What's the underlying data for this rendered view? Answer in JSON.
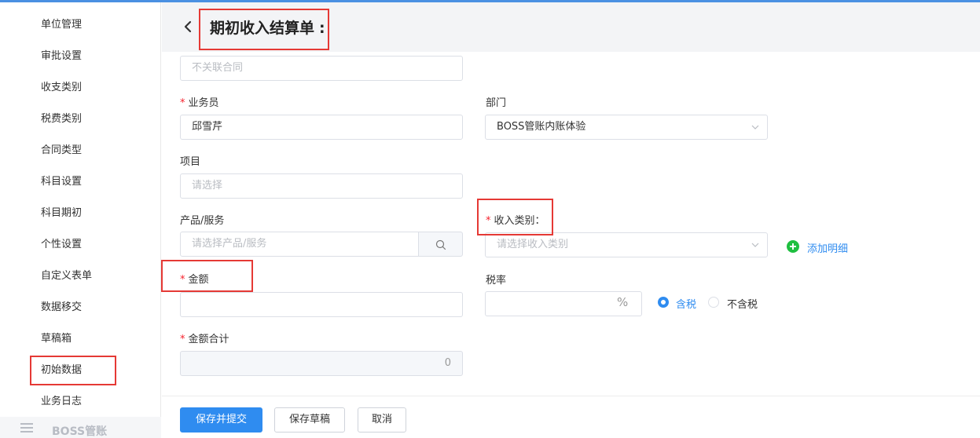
{
  "sidebar": {
    "items": [
      {
        "label": "单位管理"
      },
      {
        "label": "审批设置"
      },
      {
        "label": "收支类别"
      },
      {
        "label": "税费类别"
      },
      {
        "label": "合同类型"
      },
      {
        "label": "科目设置"
      },
      {
        "label": "科目期初"
      },
      {
        "label": "个性设置"
      },
      {
        "label": "自定义表单"
      },
      {
        "label": "数据移交"
      },
      {
        "label": "草稿箱"
      },
      {
        "label": "初始数据"
      },
      {
        "label": "业务日志"
      }
    ],
    "group_label": "BOSS管账",
    "group_icon": "menu-collapse-icon"
  },
  "header": {
    "title": "期初收入结算单",
    "title_suffix": ":",
    "back_icon": "chevron-left-icon"
  },
  "form": {
    "contract": {
      "placeholder": "不关联合同"
    },
    "salesperson": {
      "label": "业务员",
      "value": "邱雪芹"
    },
    "department": {
      "label": "部门",
      "value": "BOSS管账内账体验"
    },
    "project": {
      "label": "项目",
      "placeholder": "请选择"
    },
    "product": {
      "label": "产品/服务",
      "placeholder": "请选择产品/服务"
    },
    "income_category": {
      "label": "收入类别：",
      "placeholder": "请选择收入类别"
    },
    "add_detail": "添加明细",
    "amount": {
      "label": "金额",
      "value": ""
    },
    "tax_rate": {
      "label": "税率",
      "value": "",
      "unit": "%"
    },
    "tax_options": [
      {
        "label": "含税",
        "checked": true
      },
      {
        "label": "不含税",
        "checked": false
      }
    ],
    "total": {
      "label": "金额合计",
      "value": "0"
    }
  },
  "footer": {
    "save_submit": "保存并提交",
    "save_draft": "保存草稿",
    "cancel": "取消"
  },
  "colors": {
    "accent": "#2f8cf0",
    "required": "#f5222d",
    "highlight": "#e53935",
    "add": "#1fbf40"
  }
}
